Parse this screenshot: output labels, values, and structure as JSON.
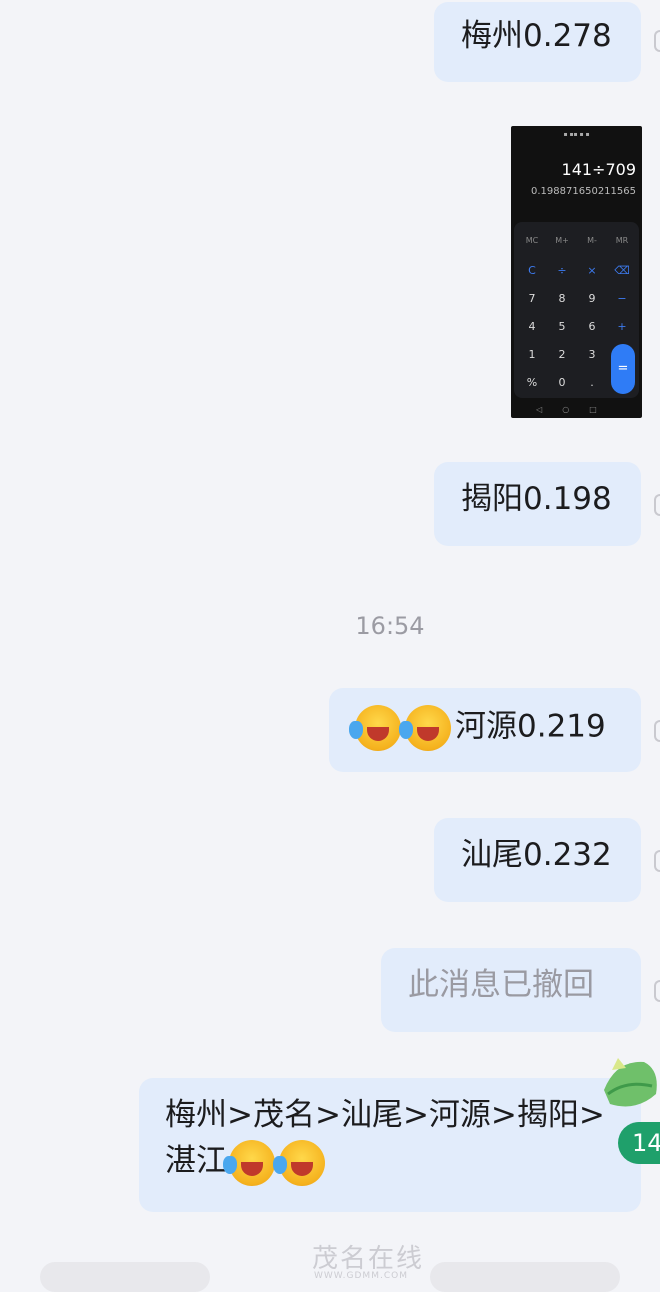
{
  "messages": {
    "m1": "梅州0.278",
    "m2": "揭阳0.198",
    "m3": "河源0.219",
    "m4": "汕尾0.232",
    "m5": "此消息已撤回",
    "m6_line1": "梅州>茂名>汕尾>河源>揭阳>",
    "m6_line2": "湛江"
  },
  "timestamp": "16:54",
  "calc_screenshot": {
    "expression": "141÷709",
    "result": "0.198871650211565",
    "memory_keys": [
      "MC",
      "M+",
      "M-",
      "MR"
    ],
    "row1": [
      "C",
      "÷",
      "×",
      "⌫"
    ],
    "row2": [
      "7",
      "8",
      "9",
      "−"
    ],
    "row3": [
      "4",
      "5",
      "6",
      "+"
    ],
    "row4": [
      "1",
      "2",
      "3"
    ],
    "row5": [
      "%",
      "0",
      "."
    ],
    "equals": "="
  },
  "badge_count": "14",
  "emoji_icon": "laughing-crying-emoji",
  "watermark": {
    "text": "茂名在线",
    "url": "WWW.GDMM.COM"
  },
  "colors": {
    "bubble": "#e2ecfb",
    "background": "#f3f4f8",
    "badge": "#1fa06b",
    "calc_accent": "#2f7cf6"
  }
}
